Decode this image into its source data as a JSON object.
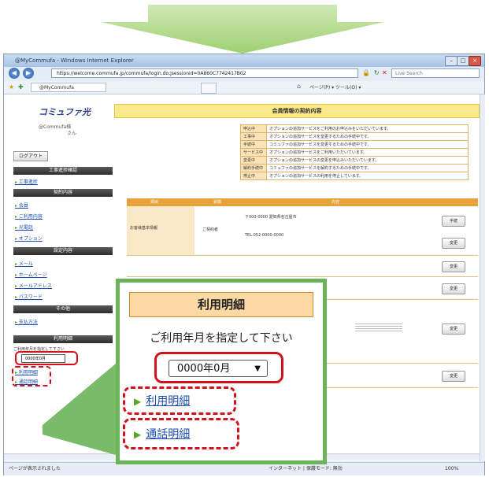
{
  "browser": {
    "title": "@MyCommufa - Windows Internet Explorer",
    "url": "https://welcome.commufa.jp/commufa/login.do;jsessionid=0A860C7742417B02",
    "search_placeholder": "Live Search",
    "tab_label": "@MyCommufa",
    "toolbar_text": "ページ(P) ▾  ツール(O) ▾",
    "status_left": "ページが表示されました",
    "status_zone": "インターネット | 保護モード: 無効",
    "zoom": "100%"
  },
  "sidebar": {
    "logo": "コミュファ光",
    "greeting": "@Commufa様",
    "greeting_suffix": "さん",
    "logout_button": "ログアウト",
    "sections": [
      {
        "label": "工事進捗確認",
        "items": [
          "工事進捗"
        ]
      },
      {
        "label": "契約内容",
        "items": [
          "会員",
          "ご利用内容",
          "光電話",
          "オプション"
        ]
      },
      {
        "label": "設定内容",
        "items": [
          "メール",
          "ホームページ",
          "メールアドレス",
          "パスワード"
        ]
      },
      {
        "label": "その他",
        "items": [
          "支払方法"
        ]
      },
      {
        "label": "利用明細",
        "items": []
      }
    ],
    "billing_prompt": "ご利用年月を指定して下さい",
    "month_select_value": "0000年0月",
    "billing_links": [
      "利用明細",
      "通話明細"
    ]
  },
  "main": {
    "header": "会員情報の契約内容",
    "legend": [
      {
        "key": "申込中",
        "text": "オプションの追加サービスをご利用のお申込みをいただいています。"
      },
      {
        "key": "工事中",
        "text": "オプションの追加サービスを変更するための手続中です。"
      },
      {
        "key": "手続中",
        "text": "コミュファの追加サービスを変更するための手続中です。"
      },
      {
        "key": "サービス中",
        "text": "オプションの追加サービスをご利用いただいています。"
      },
      {
        "key": "変更中",
        "text": "オプションの追加サービスの変更を申込みいただいています。"
      },
      {
        "key": "解約手続中",
        "text": "コミュファの追加サービスを解約するための手続中です。"
      },
      {
        "key": "停止中",
        "text": "オプションの追加サービスの利用を停止しています。"
      }
    ],
    "table_headers": [
      "項目",
      "状態",
      "内容"
    ],
    "rows": [
      {
        "label": "お客様基本情報",
        "status": "ご契約者",
        "detail": "〒000-0000 愛知県名古屋市",
        "button": "手続"
      },
      {
        "label": "",
        "status": "",
        "detail": "TEL 052-0000-0000",
        "button": "変更"
      },
      {
        "label": "",
        "status": "",
        "detail": "",
        "button": "変更"
      },
      {
        "label": "",
        "status": "",
        "detail": "",
        "button": "変更"
      },
      {
        "label": "",
        "status": "",
        "detail": "",
        "button": "変更"
      }
    ]
  },
  "zoom_panel": {
    "title": "利用明細",
    "prompt": "ご利用年月を指定して下さい",
    "select_value": "0000年0月",
    "link_billing": "利用明細",
    "link_calls": "通話明細"
  },
  "colors": {
    "arrow": "#b7dc8c",
    "zoom_border": "#6cb45a",
    "highlight": "#d3111b",
    "title_bg": "#fdd9a3",
    "header_yellow": "#fce98a",
    "table_orange": "#e8a23c"
  }
}
